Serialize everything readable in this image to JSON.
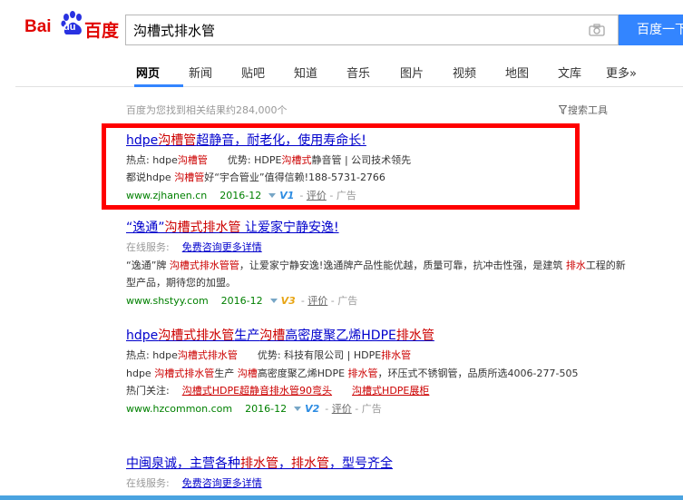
{
  "logo": {
    "bai": "Bai",
    "du": "du",
    "cn": "百度"
  },
  "search": {
    "value": "沟槽式排水管",
    "button": "百度一下"
  },
  "tabs": [
    "网页",
    "新闻",
    "贴吧",
    "知道",
    "音乐",
    "图片",
    "视频",
    "地图",
    "文库",
    "更多»"
  ],
  "result_count": "百度为您找到相关结果约284,000个",
  "tools": "搜索工具",
  "results": [
    {
      "title_parts": [
        "hdpe",
        "沟槽管",
        "超静音，耐老化，使用寿命长!"
      ],
      "line1": {
        "p1": "热点: hdpe",
        "p2": "沟槽管",
        "p3": "优势: HDPE",
        "p4": "沟槽式",
        "p5": "静音管 | 公司技术领先"
      },
      "line2": {
        "p1": "都说hdpe ",
        "p2": "沟槽管",
        "p3": "好“宇合管业”值得信赖!188-5731-2766"
      },
      "url": "www.zjhanen.cn",
      "date": "2016-12",
      "badge": "V1",
      "eval": "评价",
      "ad": "- 广告"
    },
    {
      "title_parts": [
        "“逸通”",
        "沟槽式排水管",
        " 让爱家宁静安逸!"
      ],
      "service_label": "在线服务:",
      "service_link": "免费咨询更多详情",
      "snippet": {
        "p1": "“逸通”牌 ",
        "p2": "沟槽式排水管管",
        "p3": "，让爱家宁静安逸!逸通牌产品性能优越，质量可靠，抗冲击性强，是建筑 ",
        "p4": "排水",
        "p5": "工程的新型产品，期待您的加盟。"
      },
      "url": "www.shstyy.com",
      "date": "2016-12",
      "badge": "V3",
      "eval": "评价",
      "ad": "- 广告"
    },
    {
      "title_parts": [
        "hdpe",
        "沟槽式排水管",
        "生产",
        "沟槽",
        "高密度聚乙烯HDPE",
        "排水管"
      ],
      "line1": {
        "p1": "热点: hdpe",
        "p2": "沟槽式排水管",
        "p3": "优势: 科技有限公司 | HDPE",
        "p4": "排水管"
      },
      "snippet": {
        "p1": "hdpe ",
        "p2": "沟槽式排水管",
        "p3": "生产 ",
        "p4": "沟槽",
        "p5": "高密度聚乙烯HDPE ",
        "p6": "排水管",
        "p7": "，环压式不锈钢管，品质所选4006-277-505"
      },
      "hot_label": "热门关注:",
      "hot_links": [
        "沟槽式HDPE超静音排水管90弯头",
        "沟槽式HDPE展柜"
      ],
      "url": "www.hzcommon.com",
      "date": "2016-12",
      "badge": "V2",
      "eval": "评价",
      "ad": "- 广告"
    },
    {
      "title_parts": [
        "中闽泉诚，主营各种",
        "排水管",
        "，",
        "排水管",
        "，型号齐全"
      ],
      "service_label": "在线服务:",
      "service_link": "免费咨询更多详情"
    }
  ],
  "colors": {
    "accent": "#3385ff",
    "link": "#0000cc",
    "highlight": "#cc0000",
    "url": "#008000",
    "annotation_box": "#ff0000"
  }
}
